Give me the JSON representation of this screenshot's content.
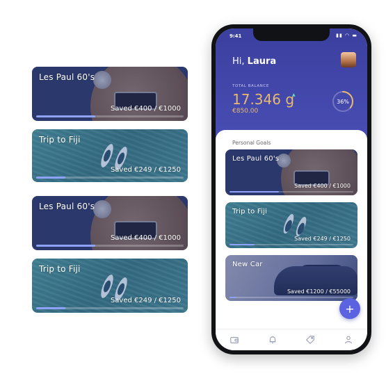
{
  "left_cards": [
    {
      "title": "Les Paul 60's",
      "saved": "Saved €400 / €1000",
      "progress": 0.4
    },
    {
      "title": "Trip to Fiji",
      "saved": "Saved €249 / €1250",
      "progress": 0.2
    },
    {
      "title": "Les Paul 60's",
      "saved": "Saved €400 / €1000",
      "progress": 0.4
    },
    {
      "title": "Trip to Fiji",
      "saved": "Saved €249 / €1250",
      "progress": 0.2
    }
  ],
  "phone": {
    "status": {
      "time": "9:41",
      "icons": "▮▮ ◠ ▬"
    },
    "greeting": {
      "prefix": "Hi, ",
      "name": "Laura"
    },
    "balance": {
      "label": "TOTAL BALANCE",
      "amount": "17.346 g",
      "sub": "€850.00",
      "percent_text": "36%",
      "percent": 0.36
    },
    "goals_label": "Personal Goals",
    "goals": [
      {
        "title": "Les Paul 60's",
        "saved": "Saved €400 / €1000",
        "progress": 0.4
      },
      {
        "title": "Trip to Fiji",
        "saved": "Saved €249 / €1250",
        "progress": 0.2
      },
      {
        "title": "New Car",
        "saved": "Saved €1200 / €55000",
        "progress": 0.05
      }
    ],
    "fab_label": "+",
    "nav": [
      "wallet-icon",
      "bell-icon",
      "tag-icon",
      "user-icon"
    ]
  },
  "colors": {
    "header": "#4a4fb6",
    "gold": "#e9b970",
    "progress": "#8fa2ff",
    "fab": "#5b63e0"
  }
}
